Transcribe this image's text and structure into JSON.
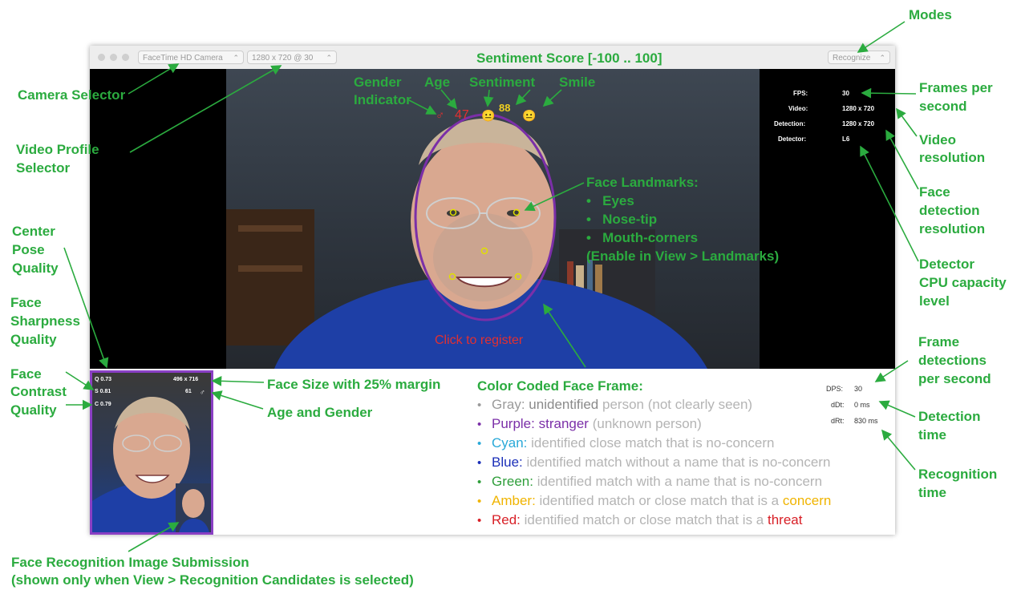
{
  "window": {
    "camera_selector": "FaceTime HD Camera",
    "video_profile": "1280 x 720 @ 30",
    "mode": "Recognize"
  },
  "video": {
    "stats": [
      {
        "label": "FPS:",
        "value": "30"
      },
      {
        "label": "Video:",
        "value": "1280 x 720"
      },
      {
        "label": "Detection:",
        "value": "1280 x 720"
      },
      {
        "label": "Detector:",
        "value": "L6"
      }
    ],
    "gender_symbol": "♂",
    "age": "47",
    "sentiment_score": "88",
    "sentiment_emoji": "😐",
    "smile_emoji": "😐",
    "register_prompt": "Click to register"
  },
  "candidate_thumbnail": {
    "q": "Q 0.73",
    "s": "S 0.81",
    "c": "C 0.79",
    "size": "496 x 716",
    "age": "61",
    "gender": "♂"
  },
  "detection_stats": [
    {
      "label": "DPS:",
      "value": "30"
    },
    {
      "label": "dDt:",
      "value": "0 ms"
    },
    {
      "label": "dRt:",
      "value": "830 ms"
    }
  ],
  "legend": {
    "title": "Color Coded Face Frame:",
    "rows": [
      {
        "color": "#9a9a9a",
        "name": "Gray:",
        "key": "unidentified",
        "keycolor": "#8a8a8a",
        "desc": "person (not clearly seen)",
        "extra": "",
        "extracolor": ""
      },
      {
        "color": "#7b2fa8",
        "name": "Purple:",
        "key": "stranger",
        "keycolor": "#7b2fa8",
        "desc": "(unknown person)",
        "extra": "",
        "extracolor": ""
      },
      {
        "color": "#29a9d8",
        "name": "Cyan:",
        "key": "",
        "keycolor": "",
        "desc": "identified close match that is no-concern",
        "extra": "",
        "extracolor": ""
      },
      {
        "color": "#1b2fb8",
        "name": "Blue:",
        "key": "",
        "keycolor": "",
        "desc": "identified match without a name that is no-concern",
        "extra": "",
        "extracolor": ""
      },
      {
        "color": "#2e9e3a",
        "name": "Green:",
        "key": "",
        "keycolor": "",
        "desc": "identified match with a name that is no-concern",
        "extra": "",
        "extracolor": ""
      },
      {
        "color": "#f0b400",
        "name": "Amber:",
        "key": "",
        "keycolor": "",
        "desc": "identified match or close match that is a",
        "extra": "concern",
        "extracolor": "#f0b400"
      },
      {
        "color": "#d81f26",
        "name": "Red:",
        "key": "",
        "keycolor": "",
        "desc": "identified match or close match that is a",
        "extra": "threat",
        "extracolor": "#d81f26"
      }
    ]
  },
  "annotations": {
    "modes": "Modes",
    "sentiment_score": "Sentiment Score [-100 .. 100]",
    "camera_selector": "Camera Selector",
    "video_profile_1": "Video Profile",
    "video_profile_2": "Selector",
    "gender_indicator_1": "Gender",
    "gender_indicator_2": "Indicator",
    "age": "Age",
    "sentiment": "Sentiment",
    "smile": "Smile",
    "fps_1": "Frames per",
    "fps_2": "second",
    "video_res_1": "Video",
    "video_res_2": "resolution",
    "face_det_res_1": "Face",
    "face_det_res_2": "detection",
    "face_det_res_3": "resolution",
    "detector_cpu_1": "Detector",
    "detector_cpu_2": "CPU capacity",
    "detector_cpu_3": "level",
    "landmarks_title": "Face Landmarks:",
    "landmarks_eyes": "Eyes",
    "landmarks_nose": "Nose-tip",
    "landmarks_mouth": "Mouth-corners",
    "landmarks_enable": "(Enable in View > Landmarks)",
    "center_pose_1": "Center",
    "center_pose_2": "Pose",
    "center_pose_3": "Quality",
    "sharpness_1": "Face",
    "sharpness_2": "Sharpness",
    "sharpness_3": "Quality",
    "contrast_1": "Face",
    "contrast_2": "Contrast",
    "contrast_3": "Quality",
    "face_size": "Face Size with 25% margin",
    "age_gender": "Age and Gender",
    "frame_det_1": "Frame",
    "frame_det_2": "detections",
    "frame_det_3": "per second",
    "det_time_1": "Detection",
    "det_time_2": "time",
    "rec_time_1": "Recognition",
    "rec_time_2": "time",
    "submission_1": "Face Recognition Image Submission",
    "submission_2": "(shown only when View > Recognition Candidates is selected)"
  },
  "colors": {
    "annotation": "#2bab3f",
    "face_frame": "#7b2fa8",
    "landmark": "#e0e000",
    "register": "#e23030"
  }
}
